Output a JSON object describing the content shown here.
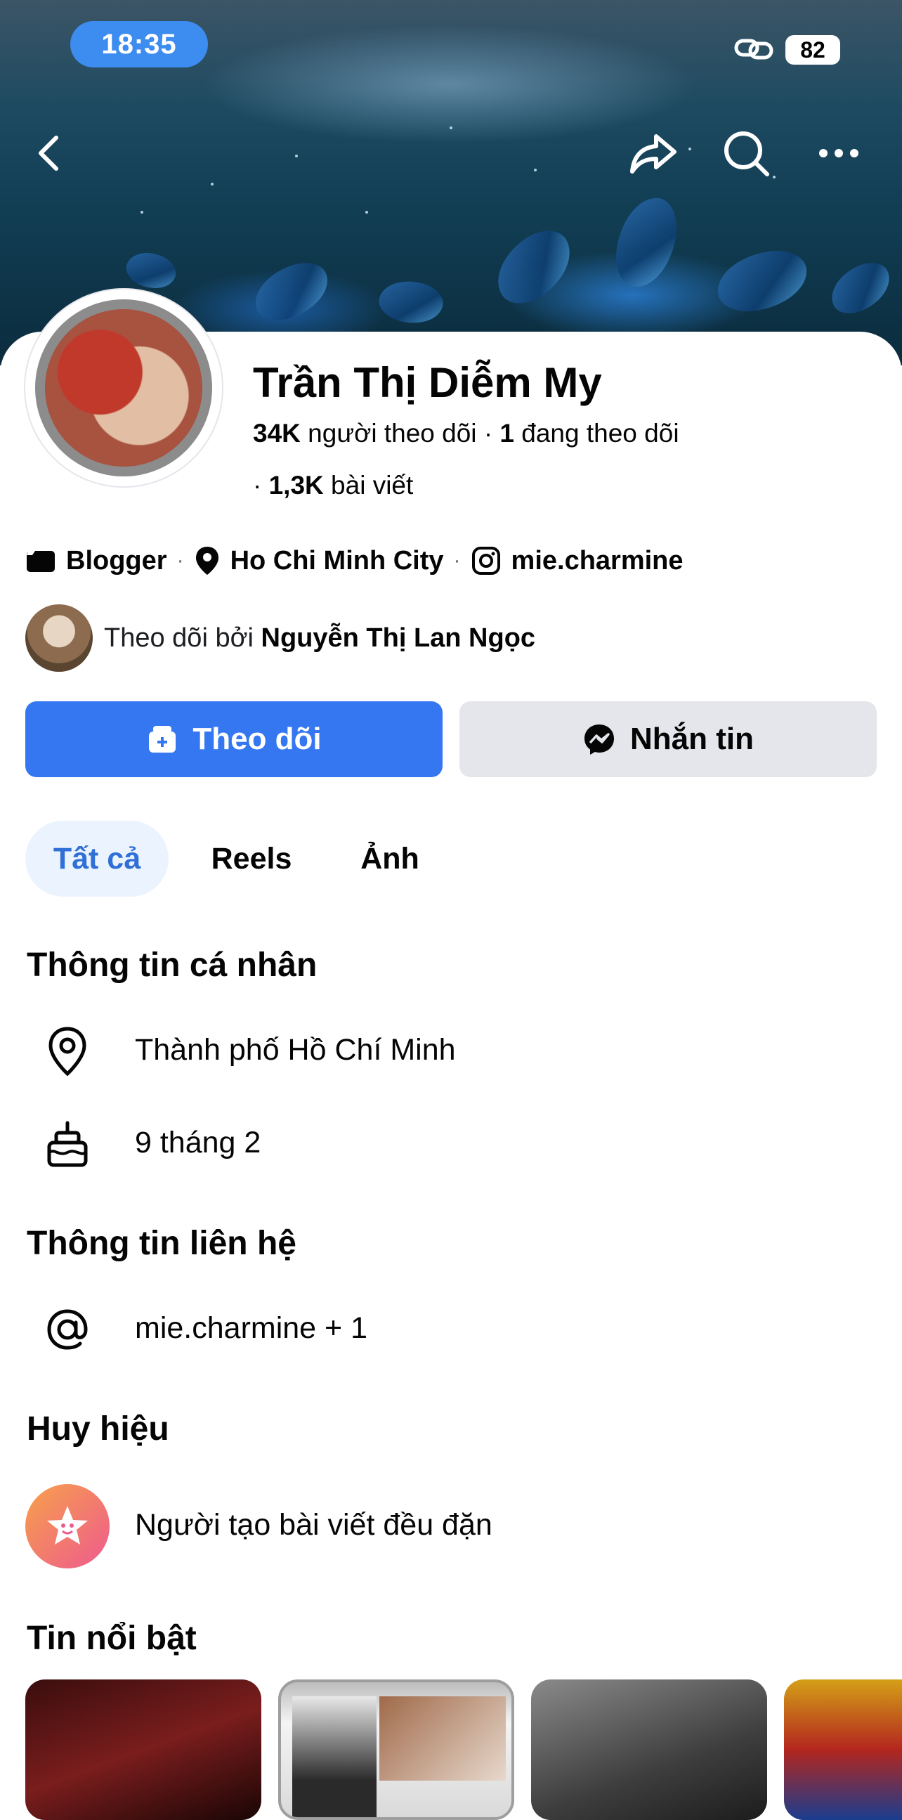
{
  "status_bar": {
    "time": "18:35",
    "battery": "82"
  },
  "profile": {
    "name": "Trần Thị Diễm My",
    "followers_count": "34K",
    "followers_label": "người theo dõi",
    "following_count": "1",
    "following_label": "đang theo dõi",
    "posts_count": "1,3K",
    "posts_label": "bài viết",
    "category": "Blogger",
    "location": "Ho Chi Minh City",
    "instagram": "mie.charmine",
    "followed_by_prefix": "Theo dõi bởi",
    "followed_by_name": "Nguyễn Thị Lan Ngọc"
  },
  "buttons": {
    "follow": "Theo dõi",
    "message": "Nhắn tin"
  },
  "tabs": [
    {
      "label": "Tất cả"
    },
    {
      "label": "Reels"
    },
    {
      "label": "Ảnh"
    }
  ],
  "sections": {
    "personal_info": {
      "title": "Thông tin cá nhân",
      "city": "Thành phố Hồ Chí Minh",
      "birthday": "9 tháng 2"
    },
    "contact_info": {
      "title": "Thông tin liên hệ",
      "handle": "mie.charmine + 1"
    },
    "badges": {
      "title": "Huy hiệu",
      "badge": "Người tạo bài viết đều đặn"
    },
    "highlights": {
      "title": "Tin nổi bật"
    }
  },
  "colors": {
    "accent": "#3577f1",
    "tab_active_bg": "#ebf3ff",
    "tab_active_text": "#2f6fd6",
    "secondary_button": "#e4e6eb"
  }
}
